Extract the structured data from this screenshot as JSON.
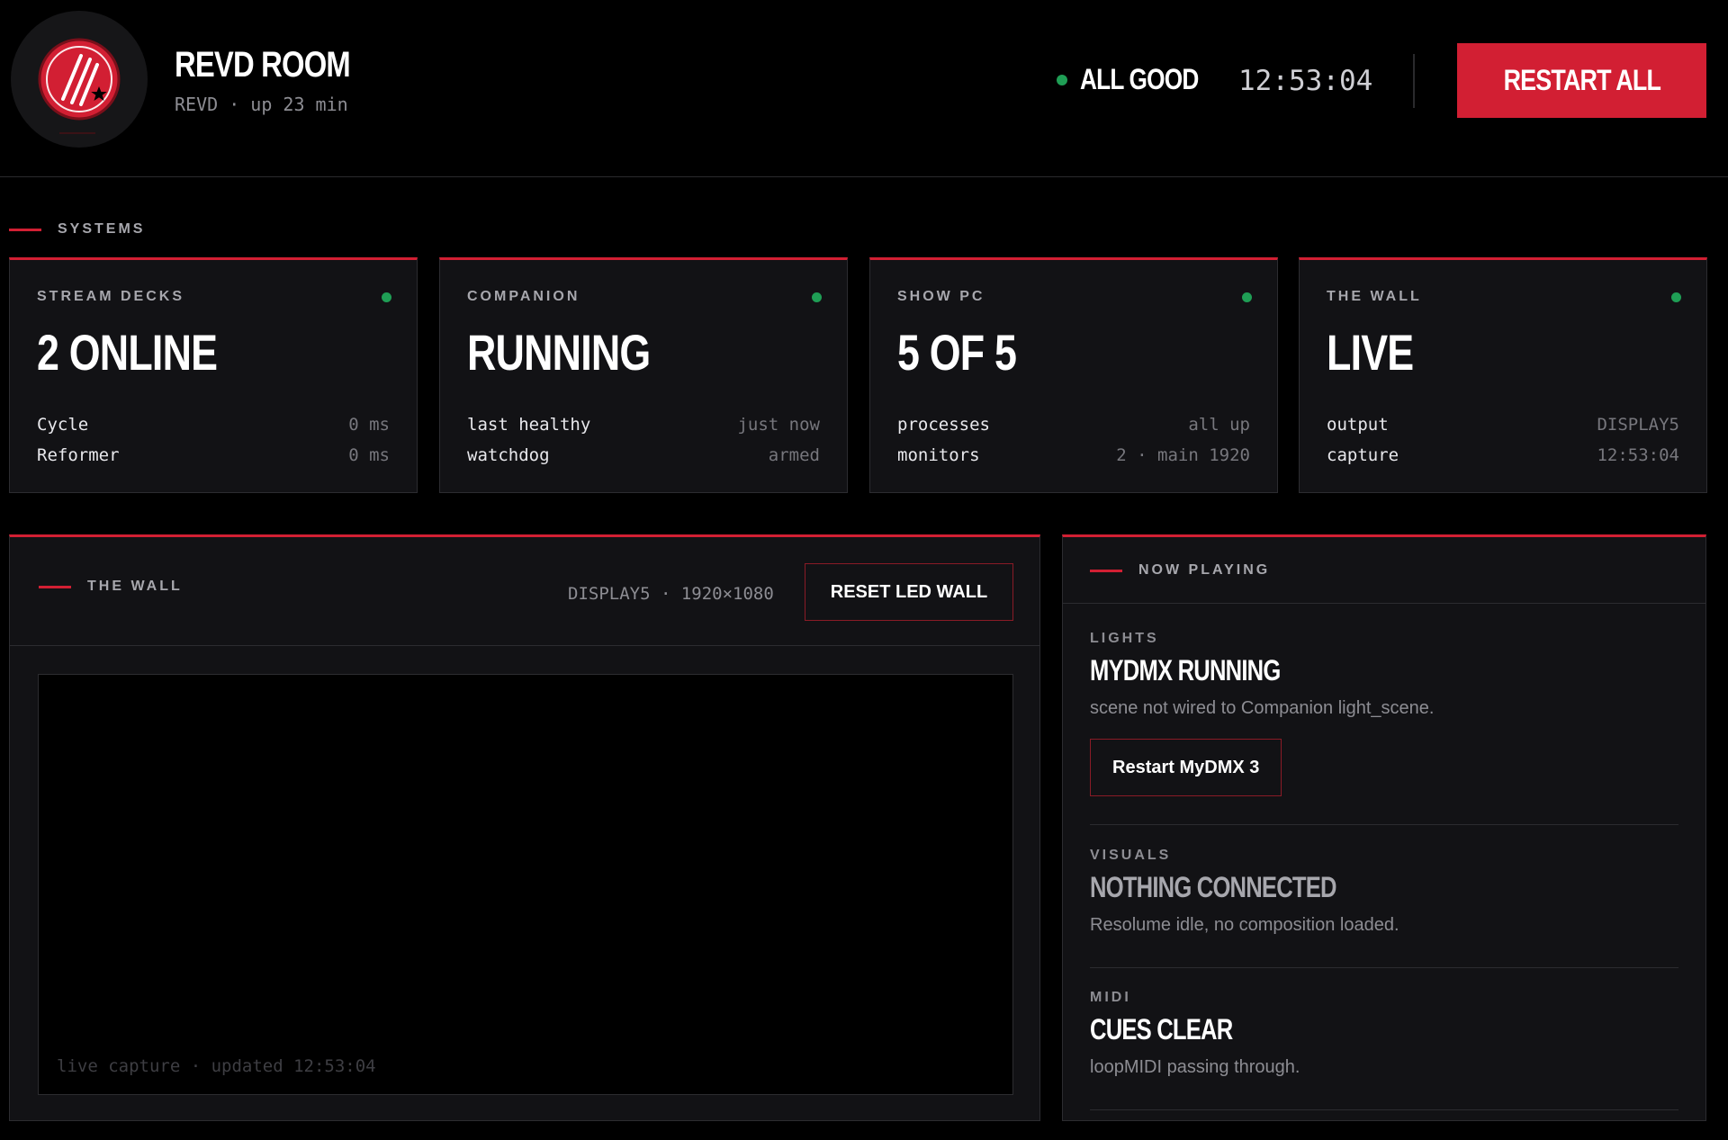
{
  "header": {
    "title": "REVD ROOM",
    "subtitle": "REVD · up 23 min",
    "status": "ALL GOOD",
    "clock": "12:53:04",
    "restart_label": "RESTART ALL"
  },
  "systems": {
    "label": "SYSTEMS",
    "cards": [
      {
        "label": "STREAM DECKS",
        "value": "2 ONLINE",
        "rows": [
          {
            "k": "Cycle",
            "v": "0 ms"
          },
          {
            "k": "Reformer",
            "v": "0 ms"
          }
        ]
      },
      {
        "label": "COMPANION",
        "value": "RUNNING",
        "rows": [
          {
            "k": "last healthy",
            "v": "just now"
          },
          {
            "k": "watchdog",
            "v": "armed"
          }
        ]
      },
      {
        "label": "SHOW PC",
        "value": "5 OF 5",
        "rows": [
          {
            "k": "processes",
            "v": "all up"
          },
          {
            "k": "monitors",
            "v": "2 · main 1920"
          }
        ]
      },
      {
        "label": "THE WALL",
        "value": "LIVE",
        "rows": [
          {
            "k": "output",
            "v": "DISPLAY5"
          },
          {
            "k": "capture",
            "v": "12:53:04"
          }
        ]
      }
    ]
  },
  "wall": {
    "title": "THE WALL",
    "spec": "DISPLAY5 · 1920×1080",
    "reset_label": "RESET LED WALL",
    "capture_text": "live capture · updated 12:53:04"
  },
  "now_playing": {
    "title": "NOW PLAYING",
    "items": [
      {
        "category": "LIGHTS",
        "name": "MYDMX RUNNING",
        "desc": "scene not wired to Companion light_scene.",
        "button": "Restart MyDMX 3"
      },
      {
        "category": "VISUALS",
        "name": "NOTHING CONNECTED",
        "desc": "Resolume idle, no composition loaded."
      },
      {
        "category": "MIDI",
        "name": "CUES CLEAR",
        "desc": "loopMIDI passing through."
      }
    ]
  },
  "colors": {
    "accent": "#d21f33",
    "ok": "#1f9e55",
    "panel": "#121215",
    "background": "#000000"
  },
  "icons": {
    "logo": "revd-logo-icon",
    "status": "status-dot-icon"
  }
}
